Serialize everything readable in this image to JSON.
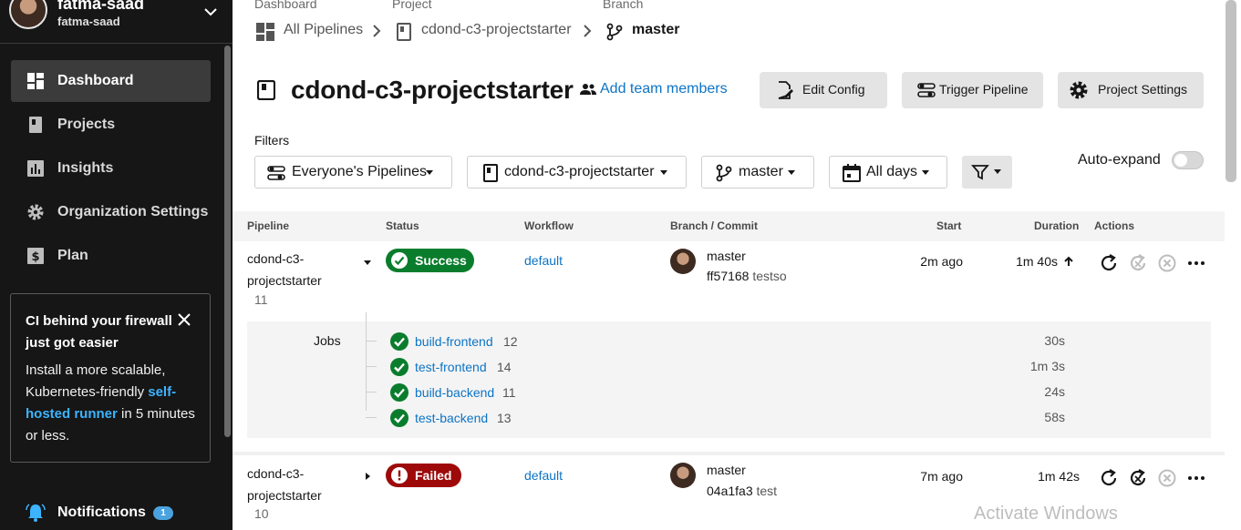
{
  "user": {
    "name": "fatma-saad",
    "handle": "fatma-saad"
  },
  "sidebar": {
    "items": [
      {
        "label": "Dashboard",
        "icon": "dashboard-icon",
        "active": true
      },
      {
        "label": "Projects",
        "icon": "projects-icon"
      },
      {
        "label": "Insights",
        "icon": "insights-icon"
      },
      {
        "label": "Organization Settings",
        "icon": "gear-icon"
      },
      {
        "label": "Plan",
        "icon": "dollar-icon"
      }
    ],
    "promo": {
      "title": "CI behind your firewall just got easier",
      "body_before": "Install a more scalable, Kubernetes-friendly ",
      "link": "self-hosted runner",
      "body_after": " in 5 minutes or less."
    },
    "notifications": {
      "label": "Notifications",
      "count": "1"
    }
  },
  "breadcrumb": {
    "dashboard_caption": "Dashboard",
    "dashboard_label": "All Pipelines",
    "project_caption": "Project",
    "project_label": "cdond-c3-projectstarter",
    "branch_caption": "Branch",
    "branch_label": "master"
  },
  "header": {
    "title": "cdond-c3-projectstarter",
    "add_team": "Add team members",
    "edit_config": "Edit Config",
    "trigger_pipeline": "Trigger Pipeline",
    "project_settings": "Project Settings"
  },
  "filters": {
    "label": "Filters",
    "pipelines": "Everyone's Pipelines",
    "project": "cdond-c3-projectstarter",
    "branch": "master",
    "days": "All days",
    "auto_expand": "Auto-expand"
  },
  "table": {
    "headers": {
      "pipeline": "Pipeline",
      "status": "Status",
      "workflow": "Workflow",
      "branch_commit": "Branch / Commit",
      "start": "Start",
      "duration": "Duration",
      "actions": "Actions"
    },
    "rows": [
      {
        "name": "cdond-c3-projectstarter",
        "number": "11",
        "status": "Success",
        "workflow": "default",
        "branch": "master",
        "sha": "ff57168",
        "message": "testso",
        "start": "2m ago",
        "duration": "1m 40s",
        "jobs_label": "Jobs",
        "jobs": [
          {
            "name": "build-frontend",
            "number": "12",
            "duration": "30s"
          },
          {
            "name": "test-frontend",
            "number": "14",
            "duration": "1m 3s"
          },
          {
            "name": "build-backend",
            "number": "11",
            "duration": "24s"
          },
          {
            "name": "test-backend",
            "number": "13",
            "duration": "58s"
          }
        ]
      },
      {
        "name": "cdond-c3-projectstarter",
        "number": "10",
        "status": "Failed",
        "workflow": "default",
        "branch": "master",
        "sha": "04a1fa3",
        "message": "test",
        "start": "7m ago",
        "duration": "1m 42s"
      }
    ]
  },
  "watermark": "Activate Windows",
  "colors": {
    "success": "#0a7d2c",
    "failed": "#9e0a0a",
    "link": "#0d74c4",
    "sidebar_bg": "#161616"
  }
}
